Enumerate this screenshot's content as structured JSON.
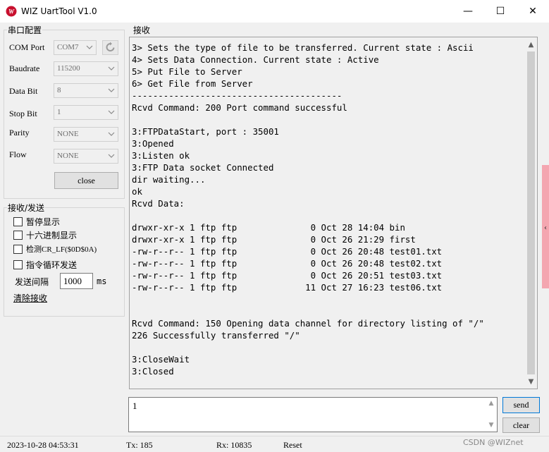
{
  "window": {
    "title": "WIZ UartTool V1.0",
    "minimize_glyph": "—",
    "maximize_glyph": "☐",
    "close_glyph": "✕"
  },
  "serial": {
    "group_title": "串口配置",
    "com_port": {
      "label": "COM Port",
      "value": "COM7"
    },
    "baudrate": {
      "label": "Baudrate",
      "value": "115200"
    },
    "data_bit": {
      "label": "Data Bit",
      "value": "8"
    },
    "stop_bit": {
      "label": "Stop Bit",
      "value": "1"
    },
    "parity": {
      "label": "Parity",
      "value": "NONE"
    },
    "flow": {
      "label": "Flow",
      "value": "NONE"
    },
    "close_button": "close"
  },
  "rxtx": {
    "group_title": "接收/发送",
    "pause_display": "暂停显示",
    "hex_display": "十六进制显示",
    "detect_crlf": "检测CR_LF($0D$0A)",
    "loop_send": "指令循环发送",
    "interval_label": "发送间隔",
    "interval_value": "1000",
    "interval_unit": "ms",
    "clear_receive": "清除接收"
  },
  "receive": {
    "title": "接收",
    "lines": [
      "3> Sets the type of file to be transferred. Current state : Ascii",
      "4> Sets Data Connection. Current state : Active",
      "5> Put File to Server",
      "6> Get File from Server",
      "----------------------------------------",
      "Rcvd Command: 200 Port command successful",
      "",
      "3:FTPDataStart, port : 35001",
      "3:Opened",
      "3:Listen ok",
      "3:FTP Data socket Connected",
      "dir waiting...",
      "ok",
      "Rcvd Data:",
      "",
      "drwxr-xr-x 1 ftp ftp              0 Oct 28 14:04 bin",
      "drwxr-xr-x 1 ftp ftp              0 Oct 26 21:29 first",
      "-rw-r--r-- 1 ftp ftp              0 Oct 26 20:48 test01.txt",
      "-rw-r--r-- 1 ftp ftp              0 Oct 26 20:48 test02.txt",
      "-rw-r--r-- 1 ftp ftp              0 Oct 26 20:51 test03.txt",
      "-rw-r--r-- 1 ftp ftp             11 Oct 27 16:23 test06.txt",
      "",
      "",
      "Rcvd Command: 150 Opening data channel for directory listing of \"/\"",
      "226 Successfully transferred \"/\"",
      "",
      "3:CloseWait",
      "3:Closed"
    ]
  },
  "send": {
    "input_value": "1",
    "send_button": "send",
    "clear_button": "clear"
  },
  "status": {
    "datetime": "2023-10-28 04:53:31",
    "tx": "Tx: 185",
    "rx": "Rx: 10835",
    "reset": "Reset"
  },
  "watermark": "CSDN @WIZnet"
}
